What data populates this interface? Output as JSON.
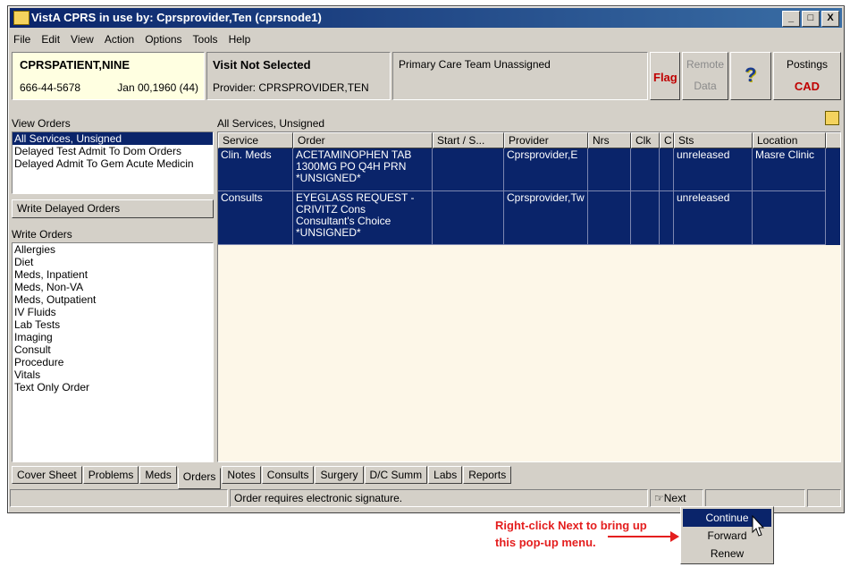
{
  "window": {
    "title": "VistA CPRS in use by: Cprsprovider,Ten  (cprsnode1)",
    "buttons": [
      "_",
      "□",
      "X"
    ]
  },
  "menu": [
    "File",
    "Edit",
    "View",
    "Action",
    "Options",
    "Tools",
    "Help"
  ],
  "patient": {
    "name": "CPRSPATIENT,NINE",
    "ssn": "666-44-5678",
    "dob": "Jan 00,1960 (44)"
  },
  "visit": {
    "title": "Visit Not Selected",
    "provider": "Provider:  CPRSPROVIDER,TEN"
  },
  "team": "Primary Care Team Unassigned",
  "flag": "Flag",
  "remote": {
    "line1": "Remote",
    "line2": "Data"
  },
  "help_icon": "?",
  "postings": {
    "line1": "Postings",
    "line2": "CAD"
  },
  "view_orders": {
    "label": "View Orders",
    "items": [
      "All Services, Unsigned",
      "Delayed Test Admit To Dom Orders",
      "Delayed Admit To Gem Acute Medicin"
    ]
  },
  "write_delayed": "Write Delayed Orders",
  "write_orders": {
    "label": "Write Orders",
    "items": [
      "Allergies",
      "Diet",
      "Meds, Inpatient",
      "Meds, Non-VA",
      "Meds, Outpatient",
      "IV Fluids",
      "Lab Tests",
      "Imaging",
      "Consult",
      "Procedure",
      "Vitals",
      "Text Only Order"
    ]
  },
  "grid": {
    "caption": "All Services, Unsigned",
    "columns": [
      "Service",
      "Order",
      "Start / S...",
      "Provider",
      "Nrs",
      "Clk",
      "C",
      "Sts",
      "Location"
    ],
    "rows": [
      {
        "service": "Clin. Meds",
        "order": [
          "ACETAMINOPHEN TAB",
          "1300MG PO Q4H PRN",
          "*UNSIGNED*"
        ],
        "start": "",
        "provider": "Cprsprovider,E",
        "nrs": "",
        "clk": "",
        "c": "",
        "sts": "unreleased",
        "location": "Masre Clinic"
      },
      {
        "service": "Consults",
        "order": [
          "EYEGLASS REQUEST -",
          "CRIVITZ Cons",
          "Consultant's Choice",
          "*UNSIGNED*"
        ],
        "start": "",
        "provider": "Cprsprovider,Tw",
        "nrs": "",
        "clk": "",
        "c": "",
        "sts": "unreleased",
        "location": ""
      }
    ]
  },
  "tabs": [
    "Cover Sheet",
    "Problems",
    "Meds",
    "Orders",
    "Notes",
    "Consults",
    "Surgery",
    "D/C Summ",
    "Labs",
    "Reports"
  ],
  "active_tab": "Orders",
  "status": {
    "message": "Order requires electronic signature.",
    "next": "Next"
  },
  "popup_menu": [
    "Continue",
    "Forward",
    "Renew"
  ],
  "annotation": [
    "Right-click Next to bring up",
    "this pop-up menu."
  ],
  "colors": {
    "selection": "#0a246a",
    "flag": "#c00000",
    "annotation": "#e41e1e",
    "window_face": "#d4d0c8"
  }
}
